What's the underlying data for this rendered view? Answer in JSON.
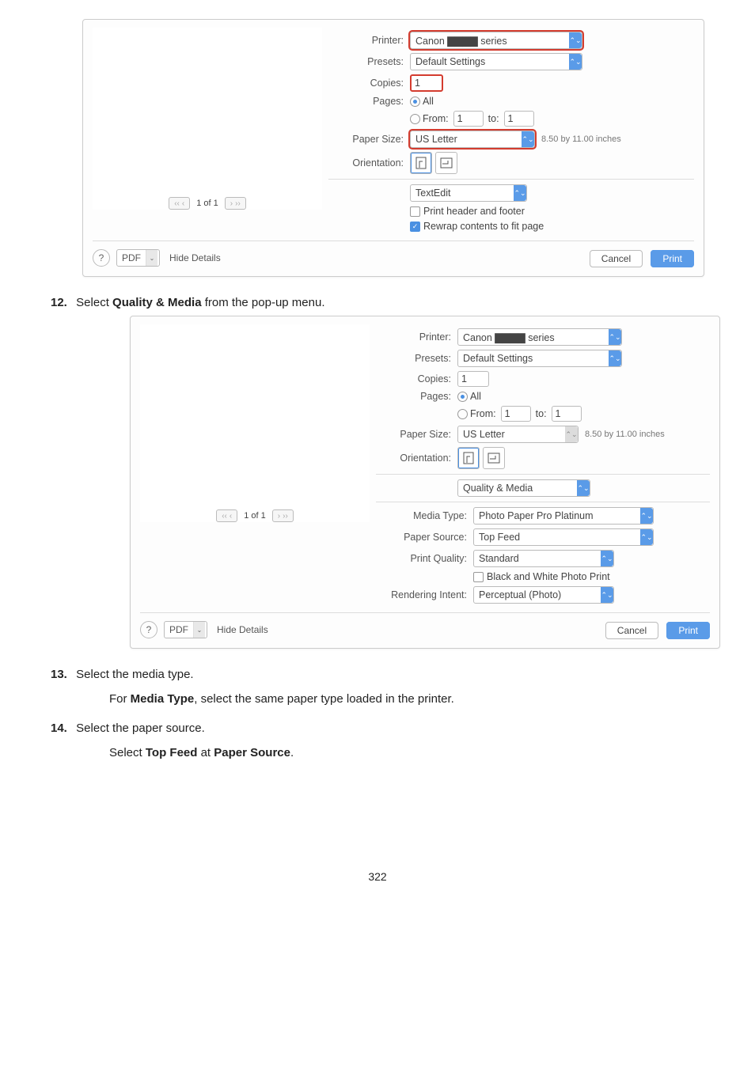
{
  "dlg1": {
    "printerLabel": "Printer:",
    "printerValue": "Canon ▇▇▇▇ series",
    "presetsLabel": "Presets:",
    "presetsValue": "Default Settings",
    "copiesLabel": "Copies:",
    "copiesValue": "1",
    "pagesLabel": "Pages:",
    "pagesAll": "All",
    "pagesFrom": "From:",
    "pagesFromVal": "1",
    "pagesTo": "to:",
    "pagesToVal": "1",
    "paperSizeLabel": "Paper Size:",
    "paperSizeValue": "US Letter",
    "paperDim": "8.50 by 11.00 inches",
    "orientationLabel": "Orientation:",
    "sectionSelect": "TextEdit",
    "opt1": "Print header and footer",
    "opt2": "Rewrap contents to fit page",
    "pageOf": "1 of 1",
    "help": "?",
    "pdf": "PDF",
    "hideDetails": "Hide Details",
    "cancel": "Cancel",
    "print": "Print"
  },
  "step12num": "12.",
  "step12text_a": "Select ",
  "step12text_b": "Quality & Media",
  "step12text_c": " from the pop-up menu.",
  "dlg2": {
    "printerLabel": "Printer:",
    "printerValue": "Canon ▇▇▇▇ series",
    "presetsLabel": "Presets:",
    "presetsValue": "Default Settings",
    "copiesLabel": "Copies:",
    "copiesValue": "1",
    "pagesLabel": "Pages:",
    "pagesAll": "All",
    "pagesFrom": "From:",
    "pagesFromVal": "1",
    "pagesTo": "to:",
    "pagesToVal": "1",
    "paperSizeLabel": "Paper Size:",
    "paperSizeValue": "US Letter",
    "paperDim": "8.50 by 11.00 inches",
    "orientationLabel": "Orientation:",
    "sectionSelect": "Quality & Media",
    "mediaTypeLabel": "Media Type:",
    "mediaTypeValue": "Photo Paper Pro Platinum",
    "paperSourceLabel": "Paper Source:",
    "paperSourceValue": "Top Feed",
    "printQualityLabel": "Print Quality:",
    "printQualityValue": "Standard",
    "bwOption": "Black and White Photo Print",
    "renderingIntentLabel": "Rendering Intent:",
    "renderingIntentValue": "Perceptual (Photo)",
    "pageOf": "1 of 1",
    "help": "?",
    "pdf": "PDF",
    "hideDetails": "Hide Details",
    "cancel": "Cancel",
    "print": "Print"
  },
  "step13num": "13.",
  "step13text": "Select the media type.",
  "step13sub_a": "For ",
  "step13sub_b": "Media Type",
  "step13sub_c": ", select the same paper type loaded in the printer.",
  "step14num": "14.",
  "step14text": "Select the paper source.",
  "step14sub_a": "Select ",
  "step14sub_b": "Top Feed",
  "step14sub_c": " at ",
  "step14sub_d": "Paper Source",
  "step14sub_e": ".",
  "pageNumber": "322"
}
